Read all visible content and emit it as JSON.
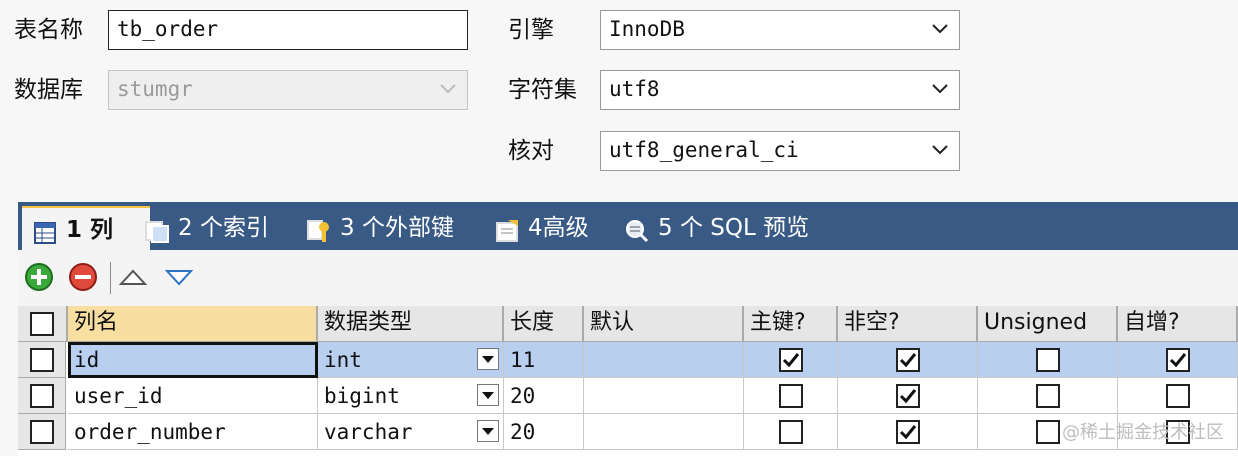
{
  "form": {
    "table_name_label": "表名称",
    "table_name_value": "tb_order",
    "database_label": "数据库",
    "database_value": "stumgr",
    "engine_label": "引擎",
    "engine_value": "InnoDB",
    "charset_label": "字符集",
    "charset_value": "utf8",
    "collation_label": "核对",
    "collation_value": "utf8_general_ci"
  },
  "tabs": [
    {
      "label": "1 列",
      "icon": "columns-icon"
    },
    {
      "label": "2 个索引",
      "icon": "index-icon"
    },
    {
      "label": "3 个外部键",
      "icon": "foreign-key-icon"
    },
    {
      "label": "4高级",
      "icon": "advanced-icon"
    },
    {
      "label": "5 个 SQL 预览",
      "icon": "sql-preview-icon"
    }
  ],
  "toolbar": {
    "add": "add-icon",
    "remove": "remove-icon",
    "up": "arrow-up-icon",
    "down": "arrow-down-icon"
  },
  "grid": {
    "headers": [
      "列名",
      "数据类型",
      "长度",
      "默认",
      "主键?",
      "非空?",
      "Unsigned",
      "自增?"
    ],
    "rows": [
      {
        "name": "id",
        "type": "int",
        "length": "11",
        "default": "",
        "pk": true,
        "notnull": true,
        "unsigned": false,
        "autoinc": true
      },
      {
        "name": "user_id",
        "type": "bigint",
        "length": "20",
        "default": "",
        "pk": false,
        "notnull": true,
        "unsigned": false,
        "autoinc": false
      },
      {
        "name": "order_number",
        "type": "varchar",
        "length": "20",
        "default": "",
        "pk": false,
        "notnull": true,
        "unsigned": false,
        "autoinc": false
      }
    ]
  },
  "watermark": "@稀土掘金技术社区",
  "colors": {
    "tabbar": "#3a5a86",
    "selected_row": "#b9cff0",
    "selected_header": "#f8dfa1"
  }
}
